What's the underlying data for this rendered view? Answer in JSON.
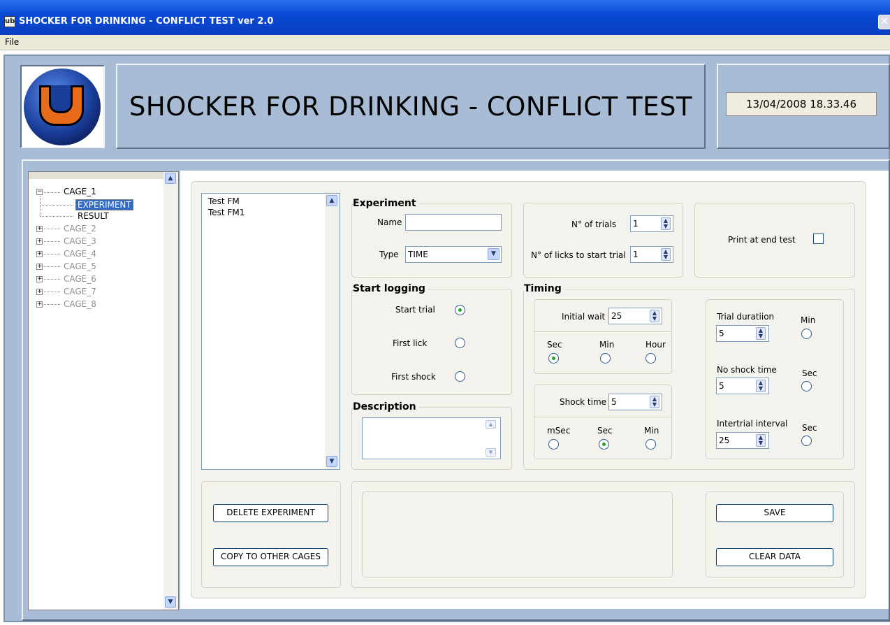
{
  "window": {
    "title": "SHOCKER FOR DRINKING - CONFLICT TEST ver 2.0",
    "app_icon": "lab-icon",
    "close_icon": "close-icon"
  },
  "menu": {
    "items": [
      "File"
    ]
  },
  "header": {
    "logo": "ub-logo",
    "heading": "SHOCKER FOR DRINKING - CONFLICT TEST",
    "datetime": "13/04/2008 18.33.46"
  },
  "tree": {
    "cages": [
      {
        "label": "CAGE_1",
        "expanded": true,
        "children": [
          "EXPERIMENT",
          "RESULT"
        ],
        "selected_child": "EXPERIMENT"
      },
      {
        "label": "CAGE_2"
      },
      {
        "label": "CAGE_3"
      },
      {
        "label": "CAGE_4"
      },
      {
        "label": "CAGE_5"
      },
      {
        "label": "CAGE_6"
      },
      {
        "label": "CAGE_7"
      },
      {
        "label": "CAGE_8"
      }
    ],
    "expand_collapsed": "+",
    "expand_open": "−"
  },
  "experiment_list": {
    "items": [
      "Test FM",
      "Test FM1"
    ]
  },
  "experiment": {
    "title": "Experiment",
    "name_label": "Name",
    "name_value": "",
    "type_label": "Type",
    "type_value": "TIME"
  },
  "trials": {
    "n_trials_label": "N° of trials",
    "n_trials_value": "1",
    "n_licks_label": "N° of licks to start trial",
    "n_licks_value": "1"
  },
  "print": {
    "label": "Print at end test",
    "checked": false
  },
  "start_logging": {
    "title": "Start logging",
    "options": [
      {
        "label": "Start trial",
        "selected": true
      },
      {
        "label": "First lick",
        "selected": false
      },
      {
        "label": "First shock",
        "selected": false
      }
    ]
  },
  "description": {
    "title": "Description",
    "value": ""
  },
  "timing": {
    "title": "Timing",
    "initial_wait_label": "Initial wait",
    "initial_wait_value": "25",
    "initial_units": [
      {
        "label": "Sec",
        "selected": true
      },
      {
        "label": "Min",
        "selected": false
      },
      {
        "label": "Hour",
        "selected": false
      }
    ],
    "shock_time_label": "Shock time",
    "shock_time_value": "5",
    "shock_units": [
      {
        "label": "mSec",
        "selected": false
      },
      {
        "label": "Sec",
        "selected": true
      },
      {
        "label": "Min",
        "selected": false
      }
    ],
    "trial_duration_label": "Trial duratiion",
    "trial_duration_value": "5",
    "trial_duration_unit": "Min",
    "no_shock_label": "No shock time",
    "no_shock_value": "5",
    "no_shock_unit": "Sec",
    "intertrial_label": "Intertrial interval",
    "intertrial_value": "25",
    "intertrial_unit": "Sec"
  },
  "buttons": {
    "delete": "DELETE EXPERIMENT",
    "copy": "COPY TO OTHER CAGES",
    "save": "SAVE",
    "clear": "CLEAR DATA"
  },
  "glyphs": {
    "scroll_up": "▲",
    "scroll_down": "▼",
    "spin_up": "▲",
    "spin_down": "▼",
    "dropdown": "▼",
    "close": "✕"
  }
}
